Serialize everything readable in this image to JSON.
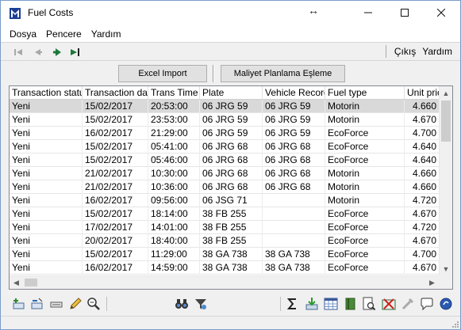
{
  "window": {
    "title": "Fuel Costs"
  },
  "menu": {
    "items": [
      "Dosya",
      "Pencere",
      "Yardım"
    ]
  },
  "nav": {
    "exit_label": "Çıkış",
    "help_label": "Yardım"
  },
  "actions": {
    "excel_import": "Excel Import",
    "maliyet": "Maliyet Planlama Eşleme"
  },
  "grid": {
    "columns": [
      "Transaction status",
      "Transaction date",
      "Trans Time",
      "Plate",
      "Vehicle Record",
      "Fuel type",
      "Unit price"
    ],
    "rows": [
      [
        "Yeni",
        "15/02/2017",
        "20:53:00",
        "06 JRG 59",
        "06 JRG 59",
        "Motorin",
        "4.660"
      ],
      [
        "Yeni",
        "15/02/2017",
        "23:53:00",
        "06 JRG 59",
        "06 JRG 59",
        "Motorin",
        "4.670"
      ],
      [
        "Yeni",
        "16/02/2017",
        "21:29:00",
        "06 JRG 59",
        "06 JRG 59",
        "EcoForce",
        "4.700"
      ],
      [
        "Yeni",
        "15/02/2017",
        "05:41:00",
        "06 JRG 68",
        "06 JRG 68",
        "EcoForce",
        "4.640"
      ],
      [
        "Yeni",
        "15/02/2017",
        "05:46:00",
        "06 JRG 68",
        "06 JRG 68",
        "EcoForce",
        "4.640"
      ],
      [
        "Yeni",
        "21/02/2017",
        "10:30:00",
        "06 JRG 68",
        "06 JRG 68",
        "Motorin",
        "4.660"
      ],
      [
        "Yeni",
        "21/02/2017",
        "10:36:00",
        "06 JRG 68",
        "06 JRG 68",
        "Motorin",
        "4.660"
      ],
      [
        "Yeni",
        "16/02/2017",
        "09:56:00",
        "06 JSG 71",
        "",
        "Motorin",
        "4.720"
      ],
      [
        "Yeni",
        "15/02/2017",
        "18:14:00",
        "38 FB 255",
        "",
        "EcoForce",
        "4.670"
      ],
      [
        "Yeni",
        "17/02/2017",
        "14:01:00",
        "38 FB 255",
        "",
        "EcoForce",
        "4.720"
      ],
      [
        "Yeni",
        "20/02/2017",
        "18:40:00",
        "38 FB 255",
        "",
        "EcoForce",
        "4.670"
      ],
      [
        "Yeni",
        "15/02/2017",
        "11:29:00",
        "38 GA 738",
        "38 GA 738",
        "EcoForce",
        "4.700"
      ],
      [
        "Yeni",
        "16/02/2017",
        "14:59:00",
        "38 GA 738",
        "38 GA 738",
        "EcoForce",
        "4.670"
      ]
    ],
    "selected_row": 0
  },
  "colors": {
    "accent": "#0078d7",
    "selected_row": "#d9d9d9"
  }
}
